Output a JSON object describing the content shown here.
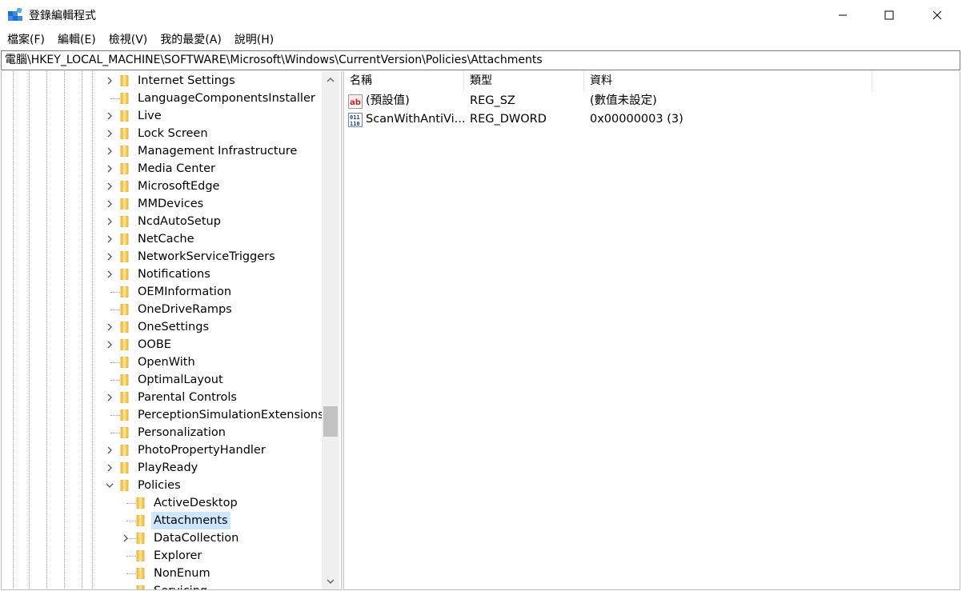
{
  "window": {
    "title": "登錄編輯程式"
  },
  "menu": [
    "檔案(F)",
    "編輯(E)",
    "檢視(V)",
    "我的最愛(A)",
    "說明(H)"
  ],
  "address": "電腦\\HKEY_LOCAL_MACHINE\\SOFTWARE\\Microsoft\\Windows\\CurrentVersion\\Policies\\Attachments",
  "tree": {
    "items": [
      {
        "label": "Internet Settings",
        "expandable": true,
        "depth": 0
      },
      {
        "label": "LanguageComponentsInstaller",
        "expandable": false,
        "depth": 0
      },
      {
        "label": "Live",
        "expandable": true,
        "depth": 0
      },
      {
        "label": "Lock Screen",
        "expandable": true,
        "depth": 0
      },
      {
        "label": "Management Infrastructure",
        "expandable": true,
        "depth": 0
      },
      {
        "label": "Media Center",
        "expandable": true,
        "depth": 0
      },
      {
        "label": "MicrosoftEdge",
        "expandable": true,
        "depth": 0
      },
      {
        "label": "MMDevices",
        "expandable": true,
        "depth": 0
      },
      {
        "label": "NcdAutoSetup",
        "expandable": true,
        "depth": 0
      },
      {
        "label": "NetCache",
        "expandable": true,
        "depth": 0
      },
      {
        "label": "NetworkServiceTriggers",
        "expandable": true,
        "depth": 0
      },
      {
        "label": "Notifications",
        "expandable": true,
        "depth": 0
      },
      {
        "label": "OEMInformation",
        "expandable": false,
        "depth": 0
      },
      {
        "label": "OneDriveRamps",
        "expandable": false,
        "depth": 0
      },
      {
        "label": "OneSettings",
        "expandable": true,
        "depth": 0
      },
      {
        "label": "OOBE",
        "expandable": true,
        "depth": 0
      },
      {
        "label": "OpenWith",
        "expandable": false,
        "depth": 0
      },
      {
        "label": "OptimalLayout",
        "expandable": false,
        "depth": 0
      },
      {
        "label": "Parental Controls",
        "expandable": true,
        "depth": 0
      },
      {
        "label": "PerceptionSimulationExtensions",
        "expandable": false,
        "depth": 0
      },
      {
        "label": "Personalization",
        "expandable": false,
        "depth": 0
      },
      {
        "label": "PhotoPropertyHandler",
        "expandable": true,
        "depth": 0
      },
      {
        "label": "PlayReady",
        "expandable": true,
        "depth": 0
      },
      {
        "label": "Policies",
        "expandable": true,
        "expanded": true,
        "depth": 0
      },
      {
        "label": "ActiveDesktop",
        "expandable": false,
        "depth": 1
      },
      {
        "label": "Attachments",
        "expandable": false,
        "depth": 1,
        "selected": true
      },
      {
        "label": "DataCollection",
        "expandable": true,
        "depth": 1
      },
      {
        "label": "Explorer",
        "expandable": false,
        "depth": 1
      },
      {
        "label": "NonEnum",
        "expandable": false,
        "depth": 1
      },
      {
        "label": "Servicing",
        "expandable": false,
        "depth": 1
      }
    ]
  },
  "values": {
    "columns": [
      "名稱",
      "類型",
      "資料"
    ],
    "rows": [
      {
        "name": "(預設值)",
        "type": "REG_SZ",
        "data": "(數值未設定)",
        "icon": "string-value-icon"
      },
      {
        "name": "ScanWithAntiVi...",
        "type": "REG_DWORD",
        "data": "0x00000003 (3)",
        "icon": "binary-value-icon"
      }
    ]
  },
  "colors": {
    "selection": "#cce8ff",
    "folder": "#f5c85a"
  }
}
